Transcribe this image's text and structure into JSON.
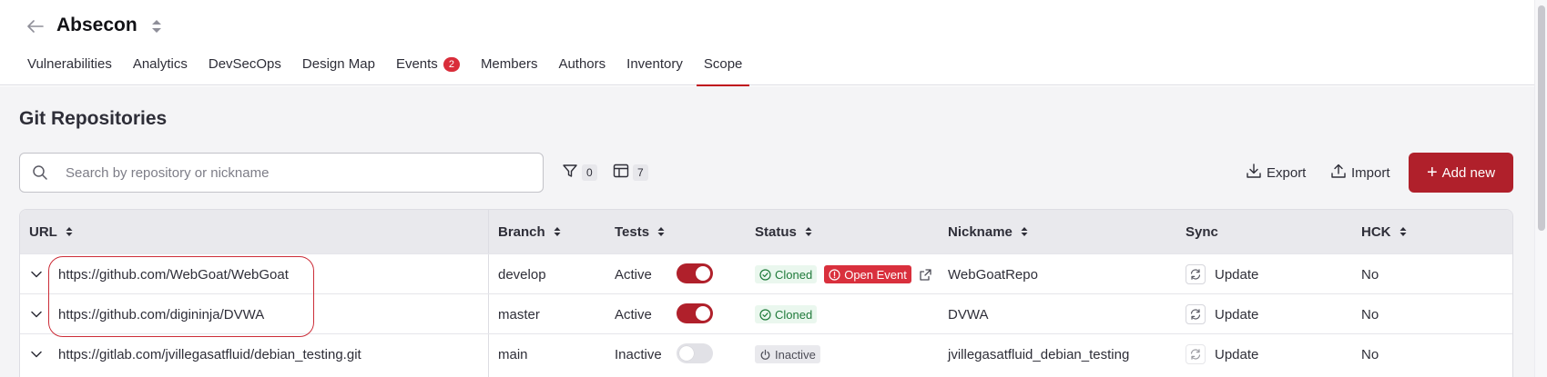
{
  "header": {
    "back_icon": "arrow-left-icon",
    "title": "Absecon",
    "switch_icon": "sort-arrows-icon",
    "tabs": [
      {
        "label": "Vulnerabilities",
        "active": false
      },
      {
        "label": "Analytics",
        "active": false
      },
      {
        "label": "DevSecOps",
        "active": false
      },
      {
        "label": "Design Map",
        "active": false
      },
      {
        "label": "Events",
        "badge": "2",
        "active": false
      },
      {
        "label": "Members",
        "active": false
      },
      {
        "label": "Authors",
        "active": false
      },
      {
        "label": "Inventory",
        "active": false
      },
      {
        "label": "Scope",
        "active": true
      }
    ]
  },
  "section": {
    "title": "Git Repositories"
  },
  "search": {
    "placeholder": "Search by repository or nickname",
    "value": ""
  },
  "toolbar": {
    "filter_count": "0",
    "columns_count": "7",
    "export_label": "Export",
    "import_label": "Import",
    "add_label": "Add new"
  },
  "table": {
    "columns": [
      "URL",
      "Branch",
      "Tests",
      "Status",
      "Nickname",
      "Sync",
      "HCK"
    ],
    "rows": [
      {
        "url": "https://github.com/WebGoat/WebGoat",
        "branch": "develop",
        "tests": "Active",
        "tests_on": true,
        "status": "Cloned",
        "event": "Open Event",
        "nickname": "WebGoatRepo",
        "sync": "Update",
        "hck": "No"
      },
      {
        "url": "https://github.com/digininja/DVWA",
        "branch": "master",
        "tests": "Active",
        "tests_on": true,
        "status": "Cloned",
        "nickname": "DVWA",
        "sync": "Update",
        "hck": "No"
      },
      {
        "url": "https://gitlab.com/jvillegasatfluid/debian_testing.git",
        "branch": "main",
        "tests": "Inactive",
        "tests_on": false,
        "status": "Inactive",
        "nickname": "jvillegasatfluid_debian_testing",
        "sync": "Update",
        "hck": "No"
      }
    ]
  },
  "colors": {
    "accent": "#b0202b",
    "badge": "#d92d3a",
    "cloned": "#1f7a3a",
    "highlight": "#cc2d38"
  }
}
